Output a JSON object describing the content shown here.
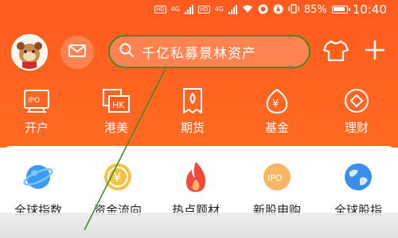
{
  "status_bar": {
    "sim1_tag": "HD",
    "sim1_net": "4G",
    "sim2_tag": "HD",
    "sim2_net": "4G",
    "battery": "85%",
    "time": "10:40",
    "icons": [
      "signal-icon",
      "wifi-icon",
      "app-icon",
      "app-icon",
      "vibrate-icon",
      "battery-icon"
    ]
  },
  "header": {
    "search_text": "千亿私募景林资产",
    "avatar_icon": "cartoon-avatar",
    "message_icon": "mail-icon",
    "skin_icon": "shirt-icon",
    "add_icon": "plus-icon"
  },
  "functions": [
    {
      "label": "开户",
      "icon": "ipo-card-icon"
    },
    {
      "label": "港美",
      "icon": "hk-icon"
    },
    {
      "label": "期货",
      "icon": "futures-icon"
    },
    {
      "label": "基金",
      "icon": "fund-icon"
    },
    {
      "label": "理财",
      "icon": "wealth-icon"
    }
  ],
  "quick": [
    {
      "label": "全球指数",
      "icon": "globe-icon"
    },
    {
      "label": "资金流向",
      "icon": "yuan-coin-icon"
    },
    {
      "label": "热点题材",
      "icon": "flame-icon"
    },
    {
      "label": "新股申购",
      "icon": "ipo-icon",
      "badge": "IPO"
    },
    {
      "label": "全球股指",
      "icon": "earth-icon"
    }
  ],
  "colors": {
    "header_bg": "#ff5b1f",
    "highlight_border": "#3d8b2a"
  }
}
